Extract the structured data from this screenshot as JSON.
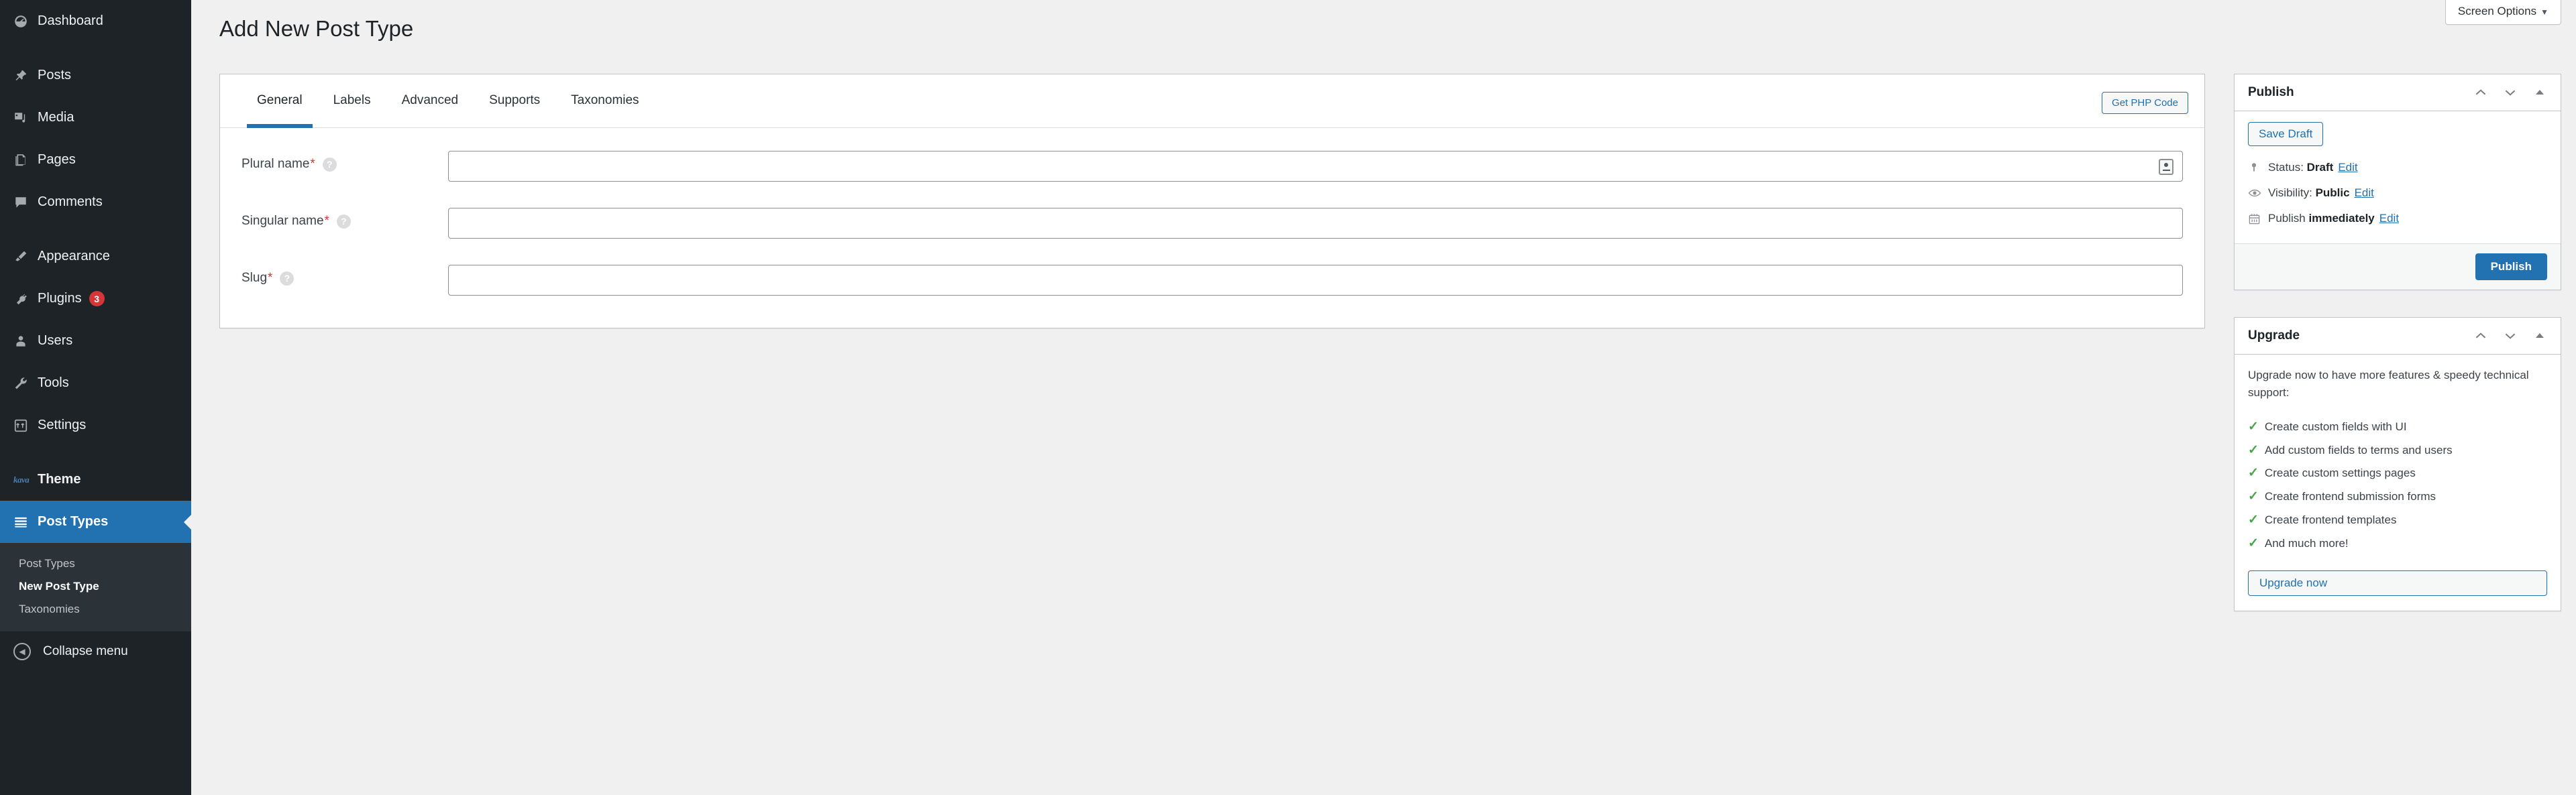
{
  "sidebar": {
    "items": [
      {
        "label": "Dashboard",
        "icon": "dashboard-icon",
        "name": "dashboard"
      },
      {
        "label": "Posts",
        "icon": "pin-icon",
        "name": "posts"
      },
      {
        "label": "Media",
        "icon": "media-icon",
        "name": "media"
      },
      {
        "label": "Pages",
        "icon": "pages-icon",
        "name": "pages"
      },
      {
        "label": "Comments",
        "icon": "comments-icon",
        "name": "comments"
      },
      {
        "label": "Appearance",
        "icon": "paintbrush-icon",
        "name": "appearance"
      },
      {
        "label": "Plugins",
        "icon": "plug-icon",
        "name": "plugins",
        "badge": "3"
      },
      {
        "label": "Users",
        "icon": "user-icon",
        "name": "users"
      },
      {
        "label": "Tools",
        "icon": "wrench-icon",
        "name": "tools"
      },
      {
        "label": "Settings",
        "icon": "settings-icon",
        "name": "settings"
      },
      {
        "label": "Theme",
        "icon": "kava-logo-icon",
        "name": "theme",
        "logo_text": "kava"
      },
      {
        "label": "Post Types",
        "icon": "post-types-icon",
        "name": "post-types",
        "current": true
      }
    ],
    "submenu": [
      {
        "label": "Post Types",
        "current": false
      },
      {
        "label": "New Post Type",
        "current": true
      },
      {
        "label": "Taxonomies",
        "current": false
      }
    ],
    "collapse_label": "Collapse menu",
    "badge_color": "#d63638",
    "active_color": "#2271b1"
  },
  "screen_meta": {
    "screen_options_label": "Screen Options",
    "caret": "▼"
  },
  "page": {
    "title": "Add New Post Type"
  },
  "form": {
    "tabs": [
      {
        "label": "General",
        "active": true
      },
      {
        "label": "Labels",
        "active": false
      },
      {
        "label": "Advanced",
        "active": false
      },
      {
        "label": "Supports",
        "active": false
      },
      {
        "label": "Taxonomies",
        "active": false
      }
    ],
    "get_php_code_label": "Get PHP Code",
    "fields": [
      {
        "label": "Plural name",
        "required": true,
        "value": "",
        "placeholder": "",
        "help": "?",
        "has_autofill": true
      },
      {
        "label": "Singular name",
        "required": true,
        "value": "",
        "placeholder": "",
        "help": "?",
        "has_autofill": false
      },
      {
        "label": "Slug",
        "required": true,
        "value": "",
        "placeholder": "",
        "help": "?",
        "has_autofill": false
      }
    ],
    "required_marker": "*"
  },
  "publish_box": {
    "title": "Publish",
    "save_draft_label": "Save Draft",
    "status_label": "Status:",
    "status_value": "Draft",
    "status_edit": "Edit",
    "visibility_label": "Visibility:",
    "visibility_value": "Public",
    "visibility_edit": "Edit",
    "schedule_label": "Publish",
    "schedule_value": "immediately",
    "schedule_edit": "Edit",
    "publish_label": "Publish"
  },
  "upgrade_box": {
    "title": "Upgrade",
    "intro": "Upgrade now to have more features & speedy technical support:",
    "features": [
      "Create custom fields with UI",
      "Add custom fields to terms and users",
      "Create custom settings pages",
      "Create frontend submission forms",
      "Create frontend templates",
      "And much more!"
    ],
    "check_glyph": "✓",
    "check_color": "#46a546",
    "button_label": "Upgrade now"
  }
}
